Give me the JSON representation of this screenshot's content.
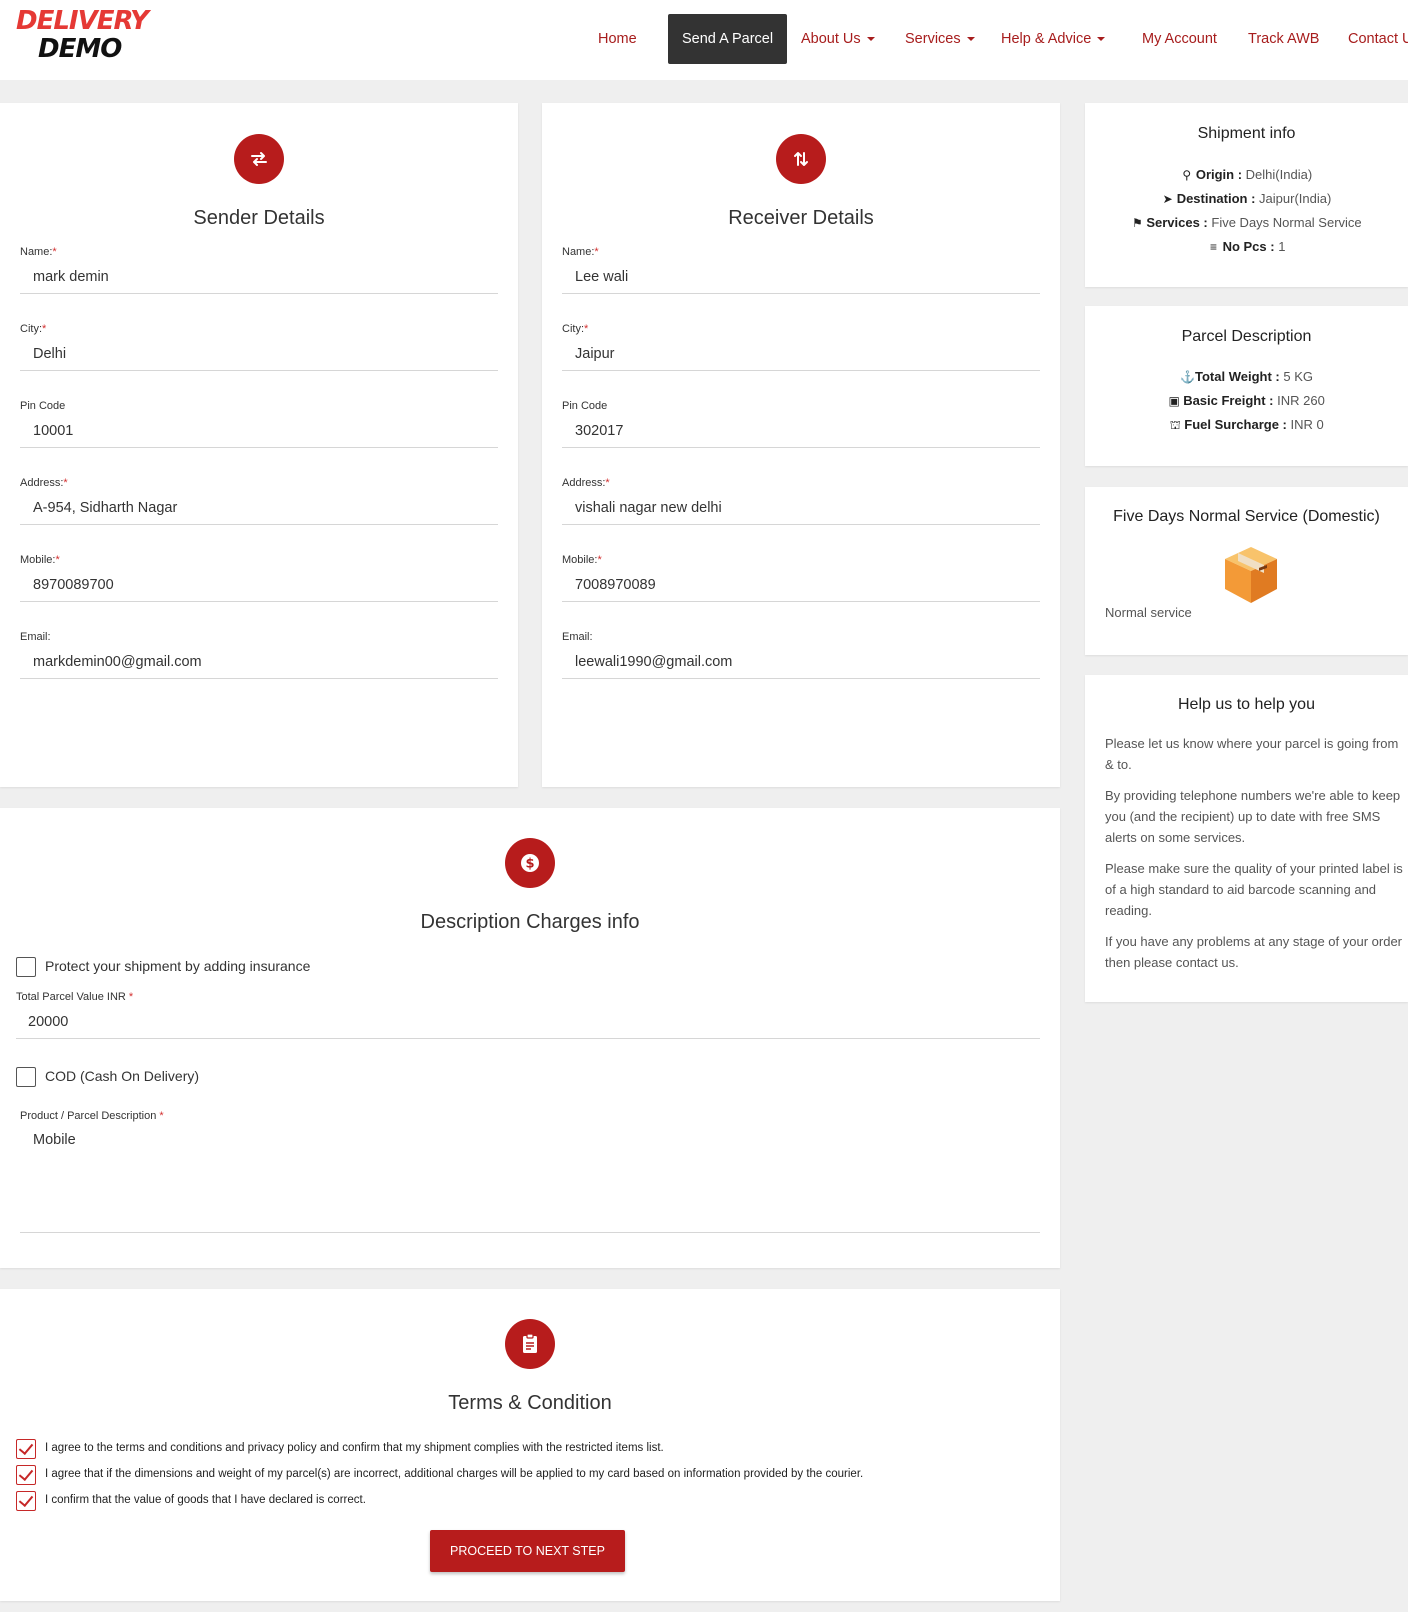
{
  "brand": {
    "line1": "DELIVERY",
    "line2": "DEMO",
    "colors": {
      "red": "#e53935",
      "dark": "#111111"
    }
  },
  "nav": {
    "home": "Home",
    "send": "Send A Parcel",
    "about": "About Us",
    "services": "Services",
    "help": "Help & Advice",
    "account": "My Account",
    "track": "Track AWB",
    "contact": "Contact U"
  },
  "sender": {
    "title": "Sender Details",
    "icon": "swap-horizontal-icon",
    "name_label": "Name:",
    "name": "mark demin",
    "city_label": "City:",
    "city": "Delhi",
    "pin_label": "Pin Code",
    "pin": "10001",
    "address_label": "Address:",
    "address": "A-954, Sidharth Nagar",
    "mobile_label": "Mobile:",
    "mobile": "8970089700",
    "email_label": "Email:",
    "email": "markdemin00@gmail.com"
  },
  "receiver": {
    "title": "Receiver Details",
    "icon": "swap-vertical-icon",
    "name_label": "Name:",
    "name": "Lee wali",
    "city_label": "City:",
    "city": "Jaipur",
    "pin_label": "Pin Code",
    "pin": "302017",
    "address_label": "Address:",
    "address": "vishali nagar new delhi",
    "mobile_label": "Mobile:",
    "mobile": "7008970089",
    "email_label": "Email:",
    "email": "leewali1990@gmail.com"
  },
  "required_mark": "*",
  "charges": {
    "title": "Description Charges info",
    "icon": "dollar-icon",
    "insurance_label": "Protect your shipment by adding insurance",
    "insurance_checked": false,
    "parcel_value_label": "Total Parcel Value INR",
    "parcel_value": "20000",
    "cod_label": "COD (Cash On Delivery)",
    "cod_checked": false,
    "description_label": "Product / Parcel Description",
    "description": "Mobile"
  },
  "terms": {
    "title": "Terms & Condition",
    "icon": "clipboard-icon",
    "items": [
      "I agree to the terms and conditions and privacy policy and confirm that my shipment complies with the restricted items list.",
      "I agree that if the dimensions and weight of my parcel(s) are incorrect, additional charges will be applied to my card based on information provided by the courier.",
      "I confirm that the value of goods that I have declared is correct."
    ],
    "proceed": "PROCEED TO NEXT STEP"
  },
  "shipment_info": {
    "title": "Shipment info",
    "origin_label": "Origin :",
    "origin": "Delhi(India)",
    "destination_label": "Destination :",
    "destination": "Jaipur(India)",
    "services_label": "Services :",
    "services": "Five Days Normal Service",
    "pcs_label": "No Pcs :",
    "pcs": "1"
  },
  "parcel_description": {
    "title": "Parcel Description",
    "weight_label": "Total Weight :",
    "weight": "5 KG",
    "freight_label": "Basic Freight :",
    "freight": "INR 260",
    "fuel_label": "Fuel Surcharge :",
    "fuel": "INR 0"
  },
  "service_card": {
    "title": "Five Days Normal Service (Domestic)",
    "icon": "parcel-box-icon",
    "note": "Normal service"
  },
  "help": {
    "title": "Help us to help you",
    "paragraphs": [
      "Please let us know where your parcel is going from & to.",
      "By providing telephone numbers we're able to keep you (and the recipient) up to date with free SMS alerts on some services.",
      "Please make sure the quality of your printed label is of a high standard to aid barcode scanning and reading.",
      "If you have any problems at any stage of your order then please contact us."
    ]
  }
}
